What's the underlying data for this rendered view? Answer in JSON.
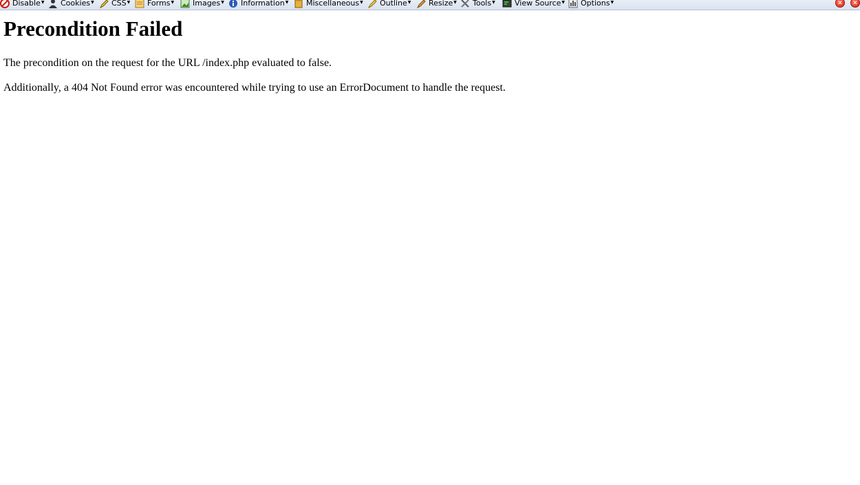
{
  "toolbar": {
    "items": [
      {
        "label": "Disable",
        "icon": "disable-icon"
      },
      {
        "label": "Cookies",
        "icon": "cookies-icon"
      },
      {
        "label": "CSS",
        "icon": "css-icon"
      },
      {
        "label": "Forms",
        "icon": "forms-icon"
      },
      {
        "label": "Images",
        "icon": "images-icon"
      },
      {
        "label": "Information",
        "icon": "information-icon"
      },
      {
        "label": "Miscellaneous",
        "icon": "miscellaneous-icon"
      },
      {
        "label": "Outline",
        "icon": "outline-icon"
      },
      {
        "label": "Resize",
        "icon": "resize-icon"
      },
      {
        "label": "Tools",
        "icon": "tools-icon"
      },
      {
        "label": "View Source",
        "icon": "view-source-icon"
      },
      {
        "label": "Options",
        "icon": "options-icon"
      }
    ],
    "close_glyph": "✕"
  },
  "page": {
    "title": "Precondition Failed",
    "message": "The precondition on the request for the URL /index.php evaluated to false.",
    "additional": "Additionally, a 404 Not Found error was encountered while trying to use an ErrorDocument to handle the request."
  },
  "colors": {
    "toolbar_bg": "#dde5f0",
    "close_red": "#d81e0a"
  }
}
